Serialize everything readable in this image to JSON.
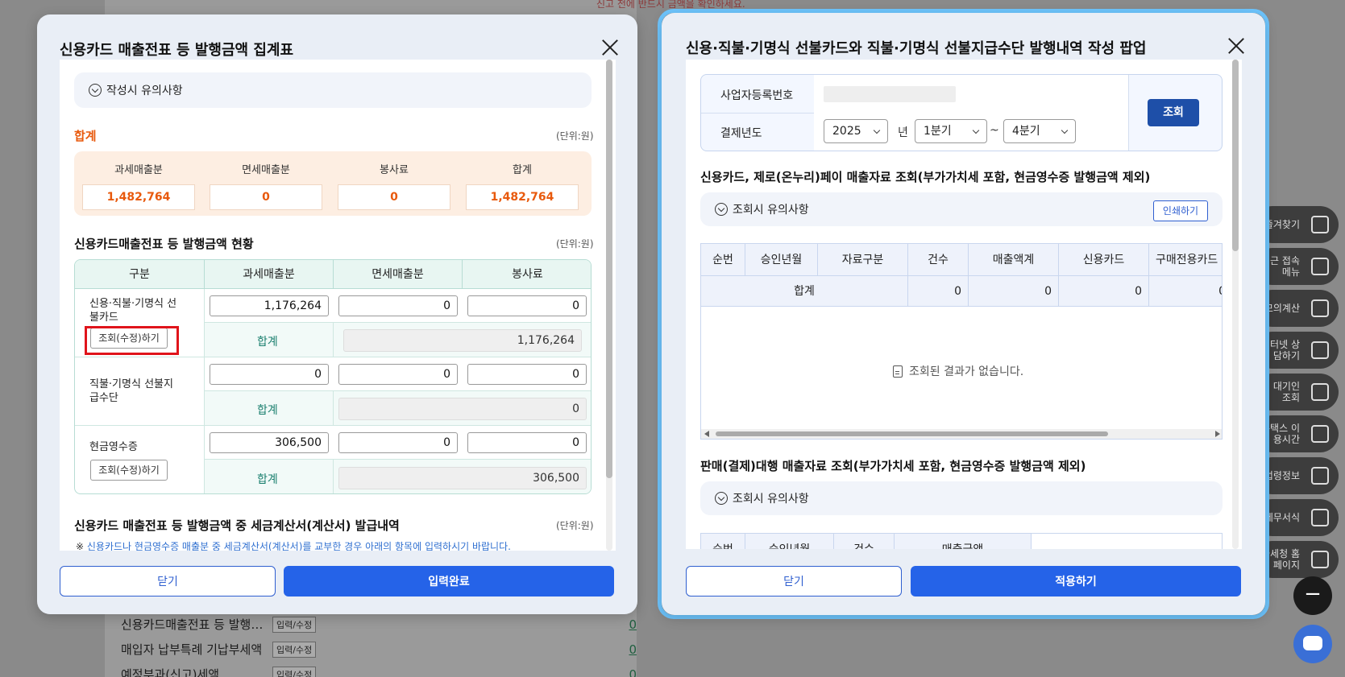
{
  "background": {
    "top_note": "신고 전에 반드시 금액을 확인하세요.",
    "rows": [
      {
        "label": "신용카드매출전표 등 발행…",
        "tag": "입력/수정",
        "value": "0"
      },
      {
        "label": "매입자 납부특례 기납부세액",
        "tag": "입력/수정",
        "value": "0"
      },
      {
        "label": "예정부과(신고)세액",
        "tag": "입력/수정",
        "value": "0"
      }
    ]
  },
  "dock": {
    "items": [
      "즐겨찾기",
      "최근 접속메뉴",
      "모의계산",
      "인터넷 상담하기",
      "실 대기인 조회",
      "홈택스 이용시간",
      "법령정보",
      "세무서식",
      "국세청 홈페이지"
    ],
    "minus": "−"
  },
  "left_modal": {
    "title": "신용카드 매출전표 등 발행금액 집계표",
    "notice": "작성시 유의사항",
    "total_title": "합계",
    "unit": "(단위:원)",
    "summary": [
      {
        "header": "과세매출분",
        "value": "1,482,764"
      },
      {
        "header": "면세매출분",
        "value": "0"
      },
      {
        "header": "봉사료",
        "value": "0"
      },
      {
        "header": "합계",
        "value": "1,482,764"
      }
    ],
    "status_title": "신용카드매출전표 등 발행금액 현황",
    "grid_headers": [
      "구분",
      "과세매출분",
      "면세매출분",
      "봉사료"
    ],
    "rows": [
      {
        "label": "신용·직불·기명식 선불카드",
        "button": "조회(수정)하기",
        "taxable": "1,176,264",
        "exempt": "0",
        "service": "0",
        "sum_label": "합계",
        "sum": "1,176,264"
      },
      {
        "label": "직불·기명식 선불지급수단",
        "button": "",
        "taxable": "0",
        "exempt": "0",
        "service": "0",
        "sum_label": "합계",
        "sum": "0"
      },
      {
        "label": "현금영수증",
        "button": "조회(수정)하기",
        "taxable": "306,500",
        "exempt": "0",
        "service": "0",
        "sum_label": "합계",
        "sum": "306,500"
      }
    ],
    "invoice_title": "신용카드 매출전표 등 발행금액 중 세금계산서(계산서) 발급내역",
    "invoice_note_mark": "※",
    "invoice_note": "신용카드나 현금영수증 매출분 중 세금계산서(계산서)를 교부한 경우 아래의 항목에 입력하시기 바랍니다.",
    "close_btn": "닫기",
    "submit_btn": "입력완료"
  },
  "right_modal": {
    "title": "신용·직불·기명식 선불카드와 직불·기명식 선불지급수단 발행내역 작성 팝업",
    "biz_label": "사업자등록번호",
    "year_label": "결제년도",
    "year": "2025",
    "year_unit": "년",
    "quarter_from": "1분기",
    "tilde": "~",
    "quarter_to": "4분기",
    "query_btn": "조회",
    "section1_title": "신용카드, 제로(온누리)페이 매출자료 조회(부가가치세 포함, 현금영수증 발행금액 제외)",
    "section1_notice": "조회시 유의사항",
    "print_btn": "인쇄하기",
    "table_headers": [
      "순번",
      "승인년월",
      "자료구분",
      "건수",
      "매출액계",
      "신용카드",
      "구매전용카드"
    ],
    "sum_row": {
      "label": "합계",
      "count": "0",
      "total": "0",
      "credit": "0",
      "purchase": "0"
    },
    "empty": "조회된 결과가 없습니다.",
    "section2_title": "판매(결제)대행 매출자료 조회(부가가치세 포함, 현금영수증 발행금액 제외)",
    "section2_notice": "조회시 유의사항",
    "table2_headers": [
      "순번",
      "승인년월",
      "건수",
      "매출금액"
    ],
    "close_btn": "닫기",
    "apply_btn": "적용하기"
  }
}
